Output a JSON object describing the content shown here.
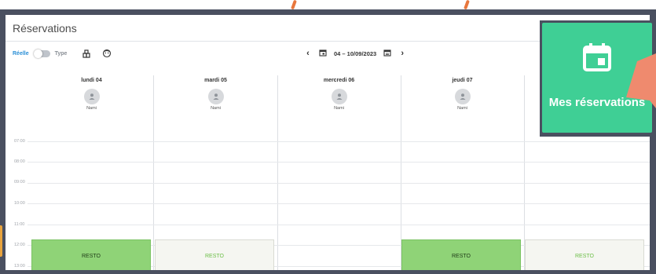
{
  "window": {
    "title": "Réservations"
  },
  "toolbar": {
    "reelle_label": "Réelle",
    "type_label": "Type",
    "date_range": "04 – 10/09/2023"
  },
  "calendar": {
    "days": [
      {
        "label": "lundi 04",
        "person": "Nami"
      },
      {
        "label": "mardi 05",
        "person": "Nami"
      },
      {
        "label": "mercredi 06",
        "person": "Nami"
      },
      {
        "label": "jeudi 07",
        "person": "Nami"
      }
    ],
    "times": [
      "07:00",
      "08:00",
      "09:00",
      "10:00",
      "11:00",
      "12:00",
      "13:00"
    ],
    "events": [
      {
        "label": "RESTO",
        "status": "booked"
      },
      {
        "label": "RESTO",
        "status": "free"
      },
      {
        "label": "RESTO",
        "status": "booked"
      },
      {
        "label": "RESTO",
        "status": "free"
      }
    ]
  },
  "callout": {
    "label": "Mes réservations"
  },
  "colors": {
    "accent": "#3fcf95",
    "booked": "#8fd377",
    "free": "#f5f6f1",
    "frame": "#4a5060",
    "pointer": "#ef8a6e"
  }
}
